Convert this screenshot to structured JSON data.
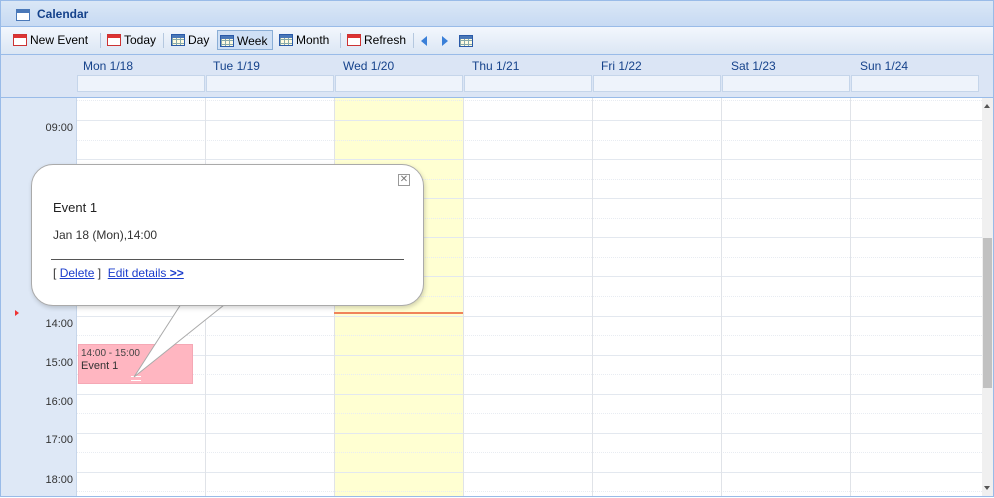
{
  "window": {
    "title": "Calendar"
  },
  "toolbar": {
    "new_event": "New Event",
    "today": "Today",
    "day": "Day",
    "week": "Week",
    "month": "Month",
    "refresh": "Refresh",
    "active_view": "Week"
  },
  "days": [
    "Mon 1/18",
    "Tue 1/19",
    "Wed 1/20",
    "Thu 1/21",
    "Fri 1/22",
    "Sat 1/23",
    "Sun 1/24"
  ],
  "hours": [
    "09:00",
    "14:00",
    "15:00",
    "16:00",
    "17:00",
    "18:00"
  ],
  "event": {
    "time": "14:00 - 15:00",
    "title": "Event 1",
    "color": "#ffb6c1"
  },
  "popup": {
    "title": "Event 1",
    "when": "Jan 18 (Mon),14:00",
    "bracket_open": "[",
    "delete_label": "Delete",
    "bracket_close": "]",
    "edit_label": "Edit details",
    "edit_arrow": ">>"
  },
  "colors": {
    "today_bg": "#ffffd2",
    "now_line": "#f0845a",
    "header_bg": "#dbe5f5",
    "accent": "#15428b"
  }
}
